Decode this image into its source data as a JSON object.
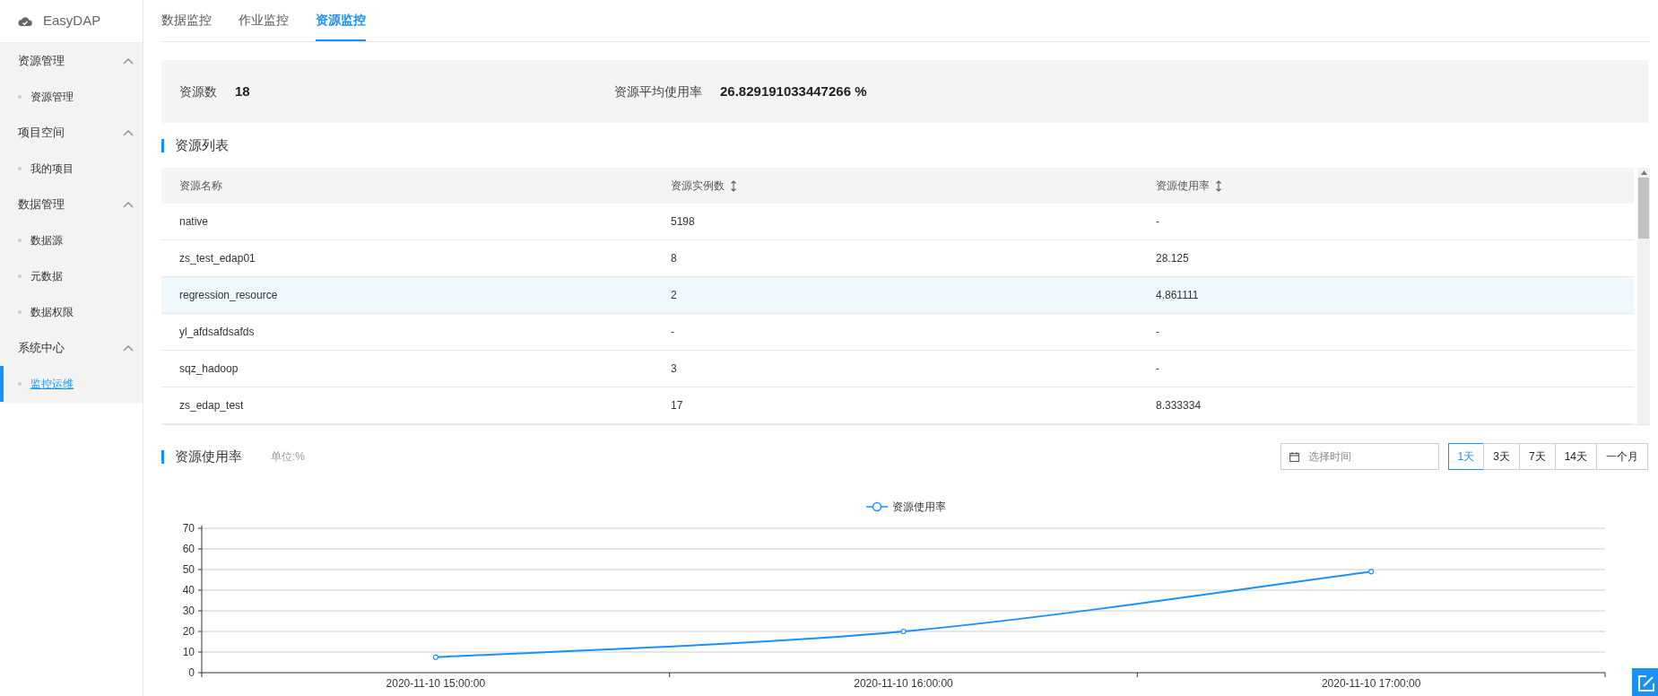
{
  "app": {
    "name": "EasyDAP"
  },
  "sidebar": {
    "groups": [
      {
        "title": "资源管理",
        "expanded": true,
        "items": [
          {
            "label": "资源管理",
            "selected": false
          }
        ]
      },
      {
        "title": "项目空间",
        "expanded": true,
        "items": [
          {
            "label": "我的项目",
            "selected": false
          }
        ]
      },
      {
        "title": "数据管理",
        "expanded": true,
        "items": [
          {
            "label": "数据源",
            "selected": false
          },
          {
            "label": "元数据",
            "selected": false
          },
          {
            "label": "数据权限",
            "selected": false
          }
        ]
      },
      {
        "title": "系统中心",
        "expanded": true,
        "items": [
          {
            "label": "监控运维",
            "selected": true
          }
        ]
      }
    ]
  },
  "tabs": [
    {
      "label": "数据监控",
      "selected": false
    },
    {
      "label": "作业监控",
      "selected": false
    },
    {
      "label": "资源监控",
      "selected": true
    }
  ],
  "stats": [
    {
      "label": "资源数",
      "value": "18"
    },
    {
      "label": "资源平均使用率",
      "value": "26.829191033447266 %"
    }
  ],
  "resource_list": {
    "title": "资源列表",
    "columns": [
      {
        "label": "资源名称",
        "sortable": false
      },
      {
        "label": "资源实例数",
        "sortable": true
      },
      {
        "label": "资源使用率",
        "sortable": true
      }
    ],
    "rows": [
      {
        "cells": [
          "native",
          "5198",
          "-"
        ],
        "selected": false
      },
      {
        "cells": [
          "zs_test_edap01",
          "8",
          "28.125"
        ],
        "selected": false
      },
      {
        "cells": [
          "regression_resource",
          "2",
          "4.861111"
        ],
        "selected": true
      },
      {
        "cells": [
          "yl_afdsafdsafds",
          "-",
          "-"
        ],
        "selected": false
      },
      {
        "cells": [
          "sqz_hadoop",
          "3",
          "-"
        ],
        "selected": false
      },
      {
        "cells": [
          "zs_edap_test",
          "17",
          "8.333334"
        ],
        "selected": false
      }
    ]
  },
  "usage": {
    "title": "资源使用率",
    "unit": "单位:%",
    "date_picker": {
      "placeholder": "选择时间"
    },
    "ranges": [
      {
        "label": "1天",
        "selected": true
      },
      {
        "label": "3天",
        "selected": false
      },
      {
        "label": "7天",
        "selected": false
      },
      {
        "label": "14天",
        "selected": false
      },
      {
        "label": "一个月",
        "selected": false
      }
    ],
    "chart_data": {
      "type": "line",
      "categories": [
        "2020-11-10 15:00:00",
        "2020-11-10 16:00:00",
        "2020-11-10 17:00:00"
      ],
      "series": [
        {
          "name": "资源使用率",
          "color": "#1890ff",
          "marker": "circle",
          "values": [
            7.5,
            20,
            49
          ]
        }
      ],
      "grid": true,
      "ylim": [
        0,
        70
      ],
      "yticks": [
        0,
        10,
        20,
        30,
        40,
        50,
        60,
        70
      ]
    }
  }
}
